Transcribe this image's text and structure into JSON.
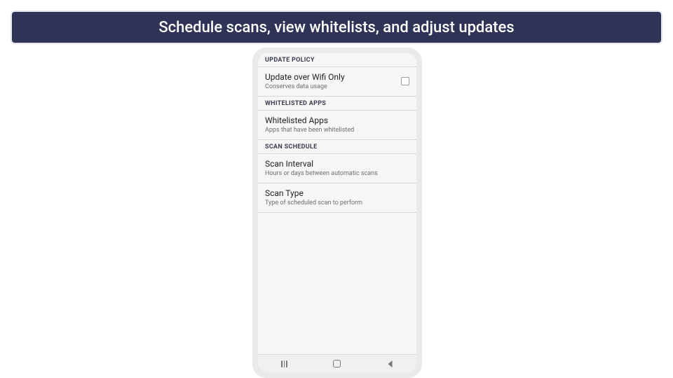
{
  "banner": {
    "text": "Schedule scans, view whitelists, and adjust updates"
  },
  "sections": {
    "update_policy": {
      "header": "UPDATE POLICY",
      "wifi": {
        "title": "Update over Wifi Only",
        "subtitle": "Conserves data usage"
      }
    },
    "whitelisted": {
      "header": "WHITELISTED APPS",
      "apps": {
        "title": "Whitelisted Apps",
        "subtitle": "Apps that have been whitelisted"
      }
    },
    "scan_schedule": {
      "header": "SCAN SCHEDULE",
      "interval": {
        "title": "Scan Interval",
        "subtitle": "Hours or days between automatic scans"
      },
      "type": {
        "title": "Scan Type",
        "subtitle": "Type of scheduled scan to perform"
      }
    }
  }
}
